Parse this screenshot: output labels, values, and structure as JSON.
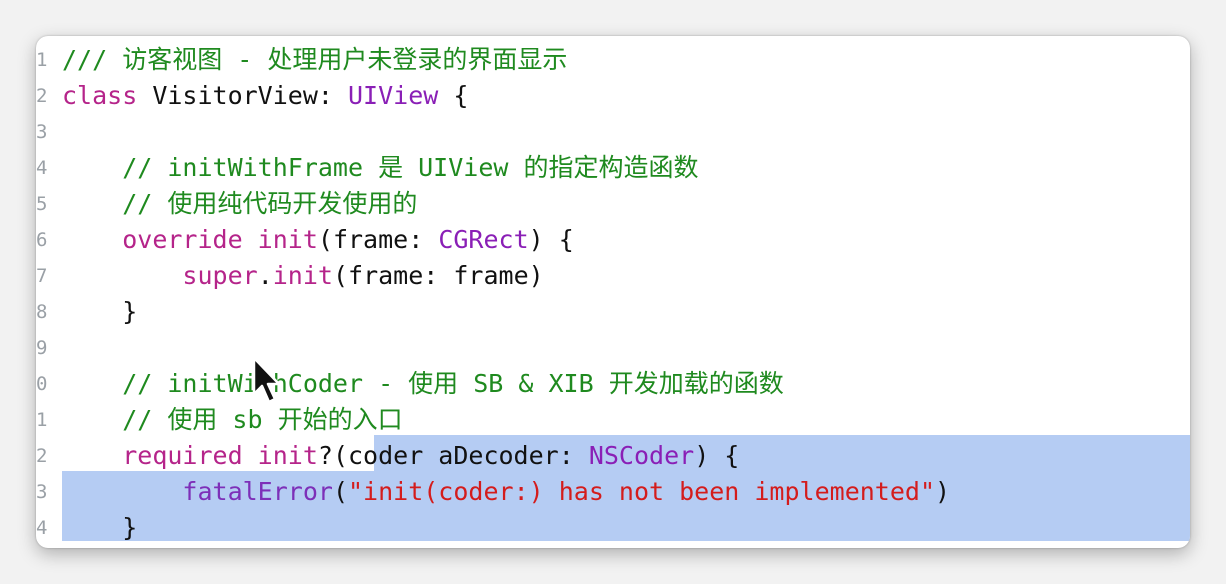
{
  "editor": {
    "line_numbers": [
      "1",
      "2",
      "3",
      "4",
      "5",
      "6",
      "7",
      "8",
      "9",
      "0",
      "1",
      "2",
      "3",
      "4"
    ],
    "lines": [
      {
        "segments": [
          {
            "t": "/// 访客视图 - 处理用户未登录的界面显示",
            "c": "cm"
          }
        ]
      },
      {
        "segments": [
          {
            "t": "class ",
            "c": "kw"
          },
          {
            "t": "VisitorView: ",
            "c": "pl"
          },
          {
            "t": "UIView",
            "c": "ty"
          },
          {
            "t": " {",
            "c": "pl"
          }
        ]
      },
      {
        "segments": []
      },
      {
        "segments": [
          {
            "t": "    // initWithFrame 是 UIView 的指定构造函数",
            "c": "cm"
          }
        ]
      },
      {
        "segments": [
          {
            "t": "    // 使用纯代码开发使用的",
            "c": "cm"
          }
        ]
      },
      {
        "segments": [
          {
            "t": "    ",
            "c": "pl"
          },
          {
            "t": "override init",
            "c": "kw"
          },
          {
            "t": "(frame: ",
            "c": "pl"
          },
          {
            "t": "CGRect",
            "c": "ty"
          },
          {
            "t": ") {",
            "c": "pl"
          }
        ]
      },
      {
        "segments": [
          {
            "t": "        ",
            "c": "pl"
          },
          {
            "t": "super",
            "c": "kw"
          },
          {
            "t": ".",
            "c": "pl"
          },
          {
            "t": "init",
            "c": "kw"
          },
          {
            "t": "(frame: frame)",
            "c": "pl"
          }
        ]
      },
      {
        "segments": [
          {
            "t": "    }",
            "c": "pl"
          }
        ]
      },
      {
        "segments": []
      },
      {
        "segments": [
          {
            "t": "    // initWithCoder - 使用 SB & XIB 开发加载的函数",
            "c": "cm"
          }
        ]
      },
      {
        "segments": [
          {
            "t": "    // 使用 sb 开始的入口",
            "c": "cm"
          }
        ]
      },
      {
        "segments": [
          {
            "t": "    ",
            "c": "pl"
          },
          {
            "t": "required init",
            "c": "kw"
          },
          {
            "t": "?(coder aDecoder: ",
            "c": "pl"
          },
          {
            "t": "NSCoder",
            "c": "ty"
          },
          {
            "t": ") {",
            "c": "pl"
          }
        ]
      },
      {
        "segments": [
          {
            "t": "        ",
            "c": "pl"
          },
          {
            "t": "fatalError",
            "c": "fn"
          },
          {
            "t": "(",
            "c": "pl"
          },
          {
            "t": "\"init(coder:) has not been implemented\"",
            "c": "str"
          },
          {
            "t": ")",
            "c": "pl"
          }
        ]
      },
      {
        "segments": [
          {
            "t": "    }",
            "c": "pl"
          }
        ]
      }
    ]
  },
  "colors": {
    "comment": "#1f8a1f",
    "keyword": "#b5248a",
    "type": "#8a1fb6",
    "function": "#7d2fb8",
    "string": "#d41c1c",
    "selection": "#b5ccf3"
  },
  "icons": {
    "cursor": "mouse-pointer-icon"
  }
}
